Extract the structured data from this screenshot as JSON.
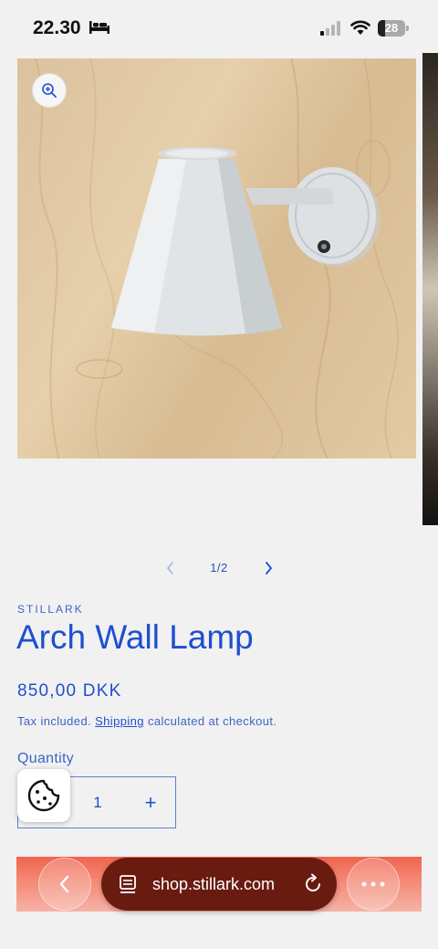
{
  "status_bar": {
    "time": "22.30",
    "battery_level": "28",
    "icons": [
      "bed-icon",
      "cellular-signal-icon",
      "wifi-icon",
      "battery-icon"
    ]
  },
  "gallery": {
    "image_subject": "Arch Wall Lamp",
    "counter": "1/2",
    "icons": [
      "zoom-in-icon",
      "chevron-left-icon",
      "chevron-right-icon"
    ]
  },
  "product": {
    "vendor": "STILLARK",
    "title": "Arch Wall Lamp",
    "price": "850,00 DKK",
    "tax_prefix": "Tax included.",
    "shipping_link": "Shipping",
    "tax_suffix": "calculated at checkout.",
    "quantity_label": "Quantity",
    "quantity_value": "1",
    "quantity_increase": "+"
  },
  "browser": {
    "url": "shop.stillark.com",
    "icons": [
      "back-chevron-icon",
      "reader-icon",
      "reload-icon",
      "more-icon",
      "cookie-icon"
    ],
    "accent_color": "#f0644f",
    "pill_color": "#6a1b10"
  },
  "colors": {
    "text_accent": "#1f4fd0",
    "background": "#f1f1f1"
  }
}
